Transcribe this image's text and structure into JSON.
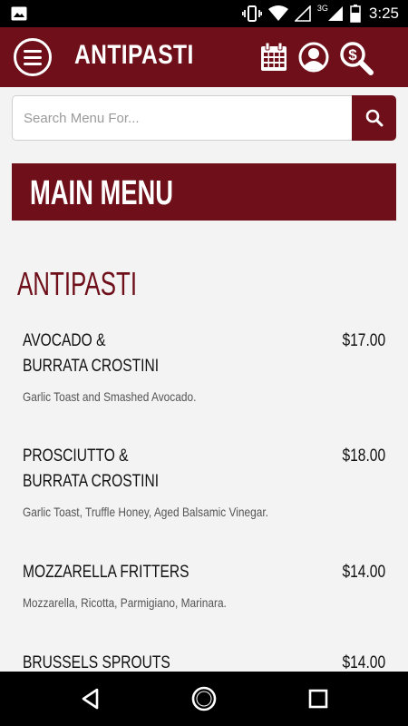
{
  "status_bar": {
    "time": "3:25",
    "network_label": "3G",
    "icons": [
      "image-notification-icon",
      "vibrate-icon",
      "wifi-icon",
      "signal-empty-icon",
      "signal-3g-icon",
      "battery-icon"
    ]
  },
  "app_bar": {
    "title": "ANTIPASTI",
    "icons": [
      "menu-icon",
      "calendar-icon",
      "account-icon",
      "price-search-icon"
    ]
  },
  "search": {
    "placeholder": "Search Menu For...",
    "value": ""
  },
  "banner": {
    "title": "MAIN MENU"
  },
  "section": {
    "heading": "ANTIPASTI"
  },
  "items": [
    {
      "name": "AVOCADO & BURRATA CROSTINI",
      "price": "$17.00",
      "description": "Garlic Toast and Smashed Avocado."
    },
    {
      "name": "PROSCIUTTO & BURRATA CROSTINI",
      "price": "$18.00",
      "description": "Garlic Toast, Truffle Honey, Aged Balsamic Vinegar."
    },
    {
      "name": "MOZZARELLA FRITTERS",
      "price": "$14.00",
      "description": "Mozzarella, Ricotta, Parmigiano, Marinara."
    },
    {
      "name": "BRUSSELS SPROUTS",
      "price": "$14.00",
      "description": ""
    }
  ],
  "colors": {
    "brand": "#6e0f19",
    "background": "#f3f3f3"
  }
}
